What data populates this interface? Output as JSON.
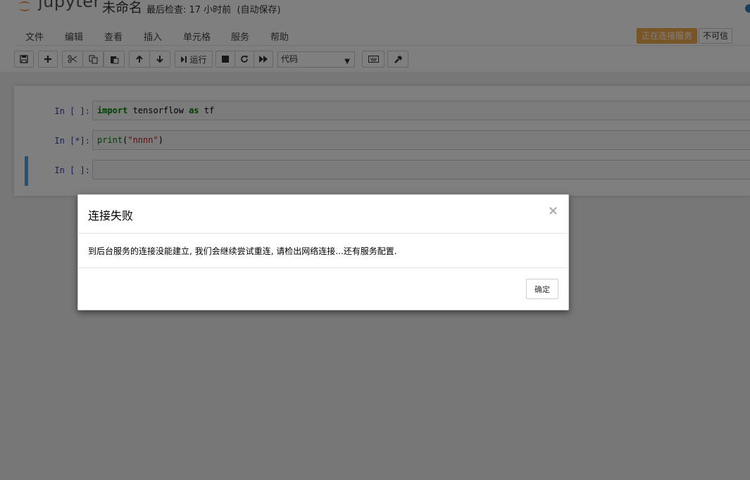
{
  "header": {
    "logo_text": "jupyter",
    "notebook_name": "未命名",
    "checkpoint": "最后检查: 17 小时前",
    "autosave": "(自动保存)"
  },
  "menubar": {
    "items": [
      "文件",
      "编辑",
      "查看",
      "插入",
      "单元格",
      "服务",
      "帮助"
    ],
    "kernel_status": "正在连接服务",
    "trust_label": "不可信"
  },
  "toolbar": {
    "run_label": "运行",
    "cell_type": "代码",
    "icons": [
      "save-icon",
      "plus-icon",
      "cut-icon",
      "copy-icon",
      "paste-icon",
      "arrow-up-icon",
      "arrow-down-icon",
      "run-icon",
      "stop-icon",
      "restart-icon",
      "fast-forward-icon",
      "keyboard-icon",
      "command-palette-icon"
    ]
  },
  "cells": [
    {
      "prompt": "In  [ ]:",
      "code_kw": "import",
      "code_rest": " tensorflow ",
      "code_kw2": "as",
      "code_tail": " tf"
    },
    {
      "prompt": "In  [*]:",
      "code_fn": "print",
      "code_open": "(",
      "code_str": "\"nnnn\"",
      "code_close": ")"
    },
    {
      "prompt": "In  [ ]:"
    }
  ],
  "modal": {
    "title": "连接失败",
    "close_glyph": "×",
    "message": "到后台服务的连接没能建立, 我们会继续尝试重连, 请检出网络连接...还有服务配置.",
    "ok_label": "确定"
  },
  "colors": {
    "accent": "#42a5f5",
    "warning": "#f0ad4e",
    "prompt": "#303f9f",
    "keyword": "#008000",
    "string": "#ba2121"
  }
}
